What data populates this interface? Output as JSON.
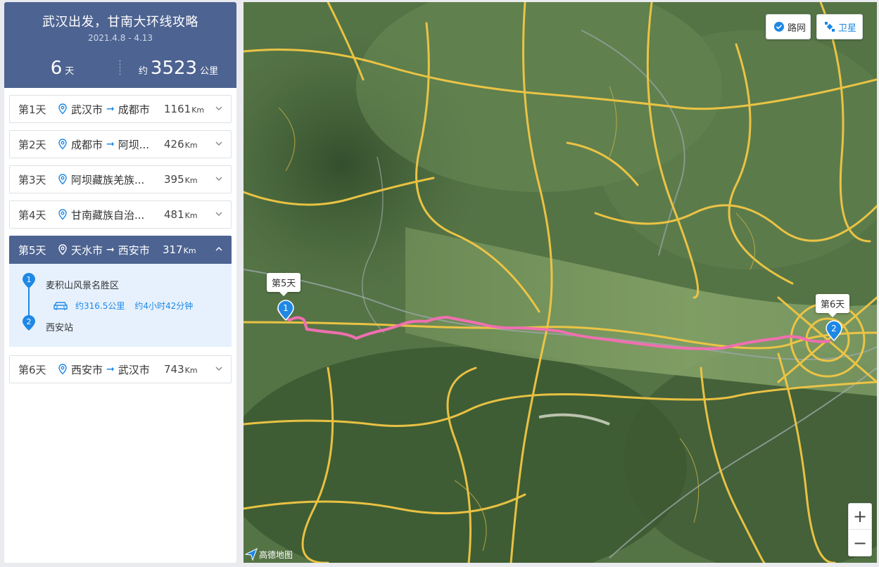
{
  "trip": {
    "title": "武汉出发，甘南大环线攻略",
    "dates": "2021.4.8 - 4.13",
    "days_value": "6",
    "days_unit": "天",
    "distance_prefix": "约",
    "distance_value": "3523",
    "distance_unit": "公里"
  },
  "days": [
    {
      "label": "第1天",
      "from": "武汉市",
      "to": "成都市",
      "dist": "1161",
      "unit": "Km"
    },
    {
      "label": "第2天",
      "from": "成都市",
      "to": "阿坝...",
      "dist": "426",
      "unit": "Km"
    },
    {
      "label": "第3天",
      "from": "阿坝藏族羌族...",
      "to": "",
      "dist": "395",
      "unit": "Km"
    },
    {
      "label": "第4天",
      "from": "甘南藏族自治...",
      "to": "",
      "dist": "481",
      "unit": "Km"
    },
    {
      "label": "第5天",
      "from": "天水市",
      "to": "西安市",
      "dist": "317",
      "unit": "Km"
    },
    {
      "label": "第6天",
      "from": "西安市",
      "to": "武汉市",
      "dist": "743",
      "unit": "Km"
    }
  ],
  "day5_detail": {
    "stop1_num": "1",
    "stop1_name": "麦积山风景名胜区",
    "route_distance": "约316.5公里",
    "route_time": "约4小时42分钟",
    "stop2_num": "2",
    "stop2_name": "西安站"
  },
  "map": {
    "road_label": "路网",
    "satellite_label": "卫星",
    "callout_start": "第5天",
    "callout_end": "第6天",
    "marker_start": "1",
    "marker_end": "2",
    "zoom_in": "+",
    "zoom_out": "−",
    "logo": "高德地图",
    "route_color": "#f06fb0",
    "road_color": "#f2c744",
    "accent": "#1e88e5"
  }
}
